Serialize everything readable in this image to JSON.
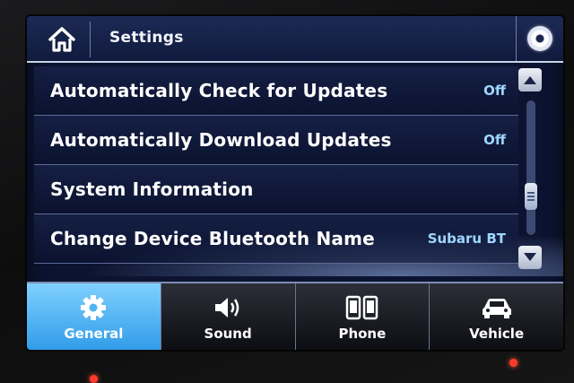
{
  "header": {
    "title": "Settings",
    "home_icon": "home-icon",
    "disc_icon": "disc-icon"
  },
  "list": {
    "rows": [
      {
        "label": "Automatically Check for Updates",
        "value": "Off"
      },
      {
        "label": "Automatically Download Updates",
        "value": "Off"
      },
      {
        "label": "System Information",
        "value": ""
      },
      {
        "label": "Change Device Bluetooth Name",
        "value": "Subaru BT"
      }
    ]
  },
  "tabs": [
    {
      "label": "General",
      "icon": "gear-icon",
      "active": true
    },
    {
      "label": "Sound",
      "icon": "speaker-icon",
      "active": false
    },
    {
      "label": "Phone",
      "icon": "phone-icon",
      "active": false
    },
    {
      "label": "Vehicle",
      "icon": "car-icon",
      "active": false
    }
  ],
  "colors": {
    "accent": "#2f9be8",
    "value_text": "#9fd6ff",
    "background": "#0b1330"
  }
}
